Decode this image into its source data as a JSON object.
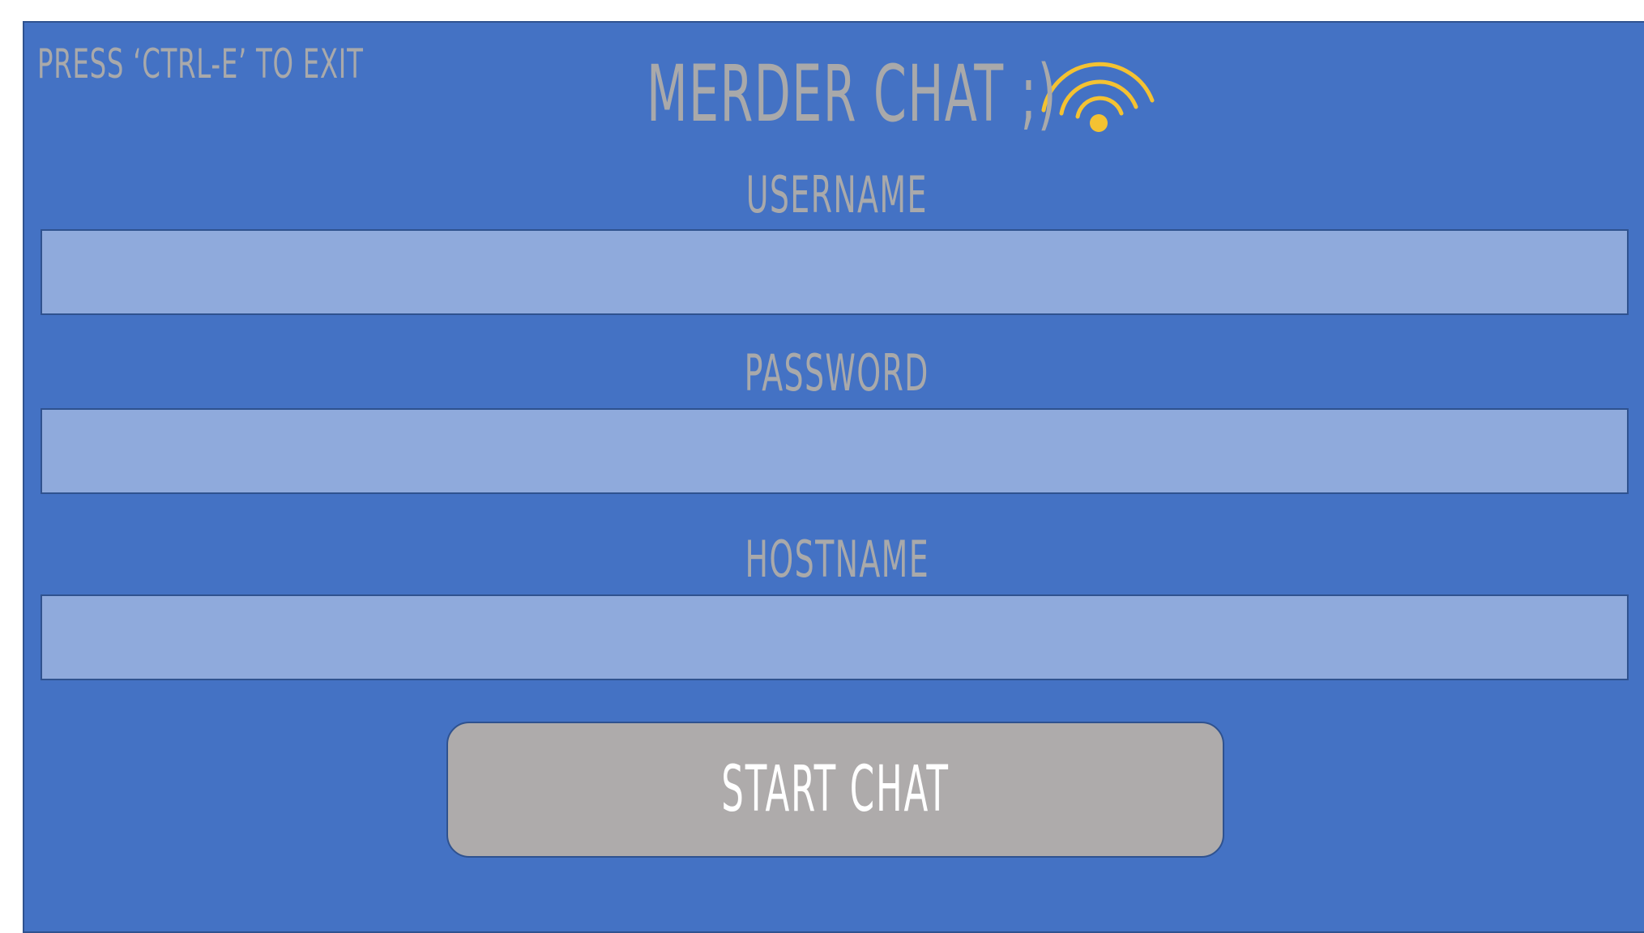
{
  "header": {
    "exit_hint": "PRESS ‘CTRL-E’ TO EXIT",
    "title": "MERDER CHAT ;)",
    "title_icon": "wifi-signal-icon"
  },
  "form": {
    "username_label": "USERNAME",
    "username_value": "",
    "password_label": "PASSWORD",
    "password_value": "",
    "hostname_label": "HOSTNAME",
    "hostname_value": "",
    "start_label": "START CHAT"
  },
  "colors": {
    "background": "#4472c4",
    "field": "#8faadc",
    "border": "#2f528f",
    "text": "#a9a9aa",
    "button": "#aeabab",
    "button_text": "#ffffff",
    "icon": "#f4c232"
  }
}
